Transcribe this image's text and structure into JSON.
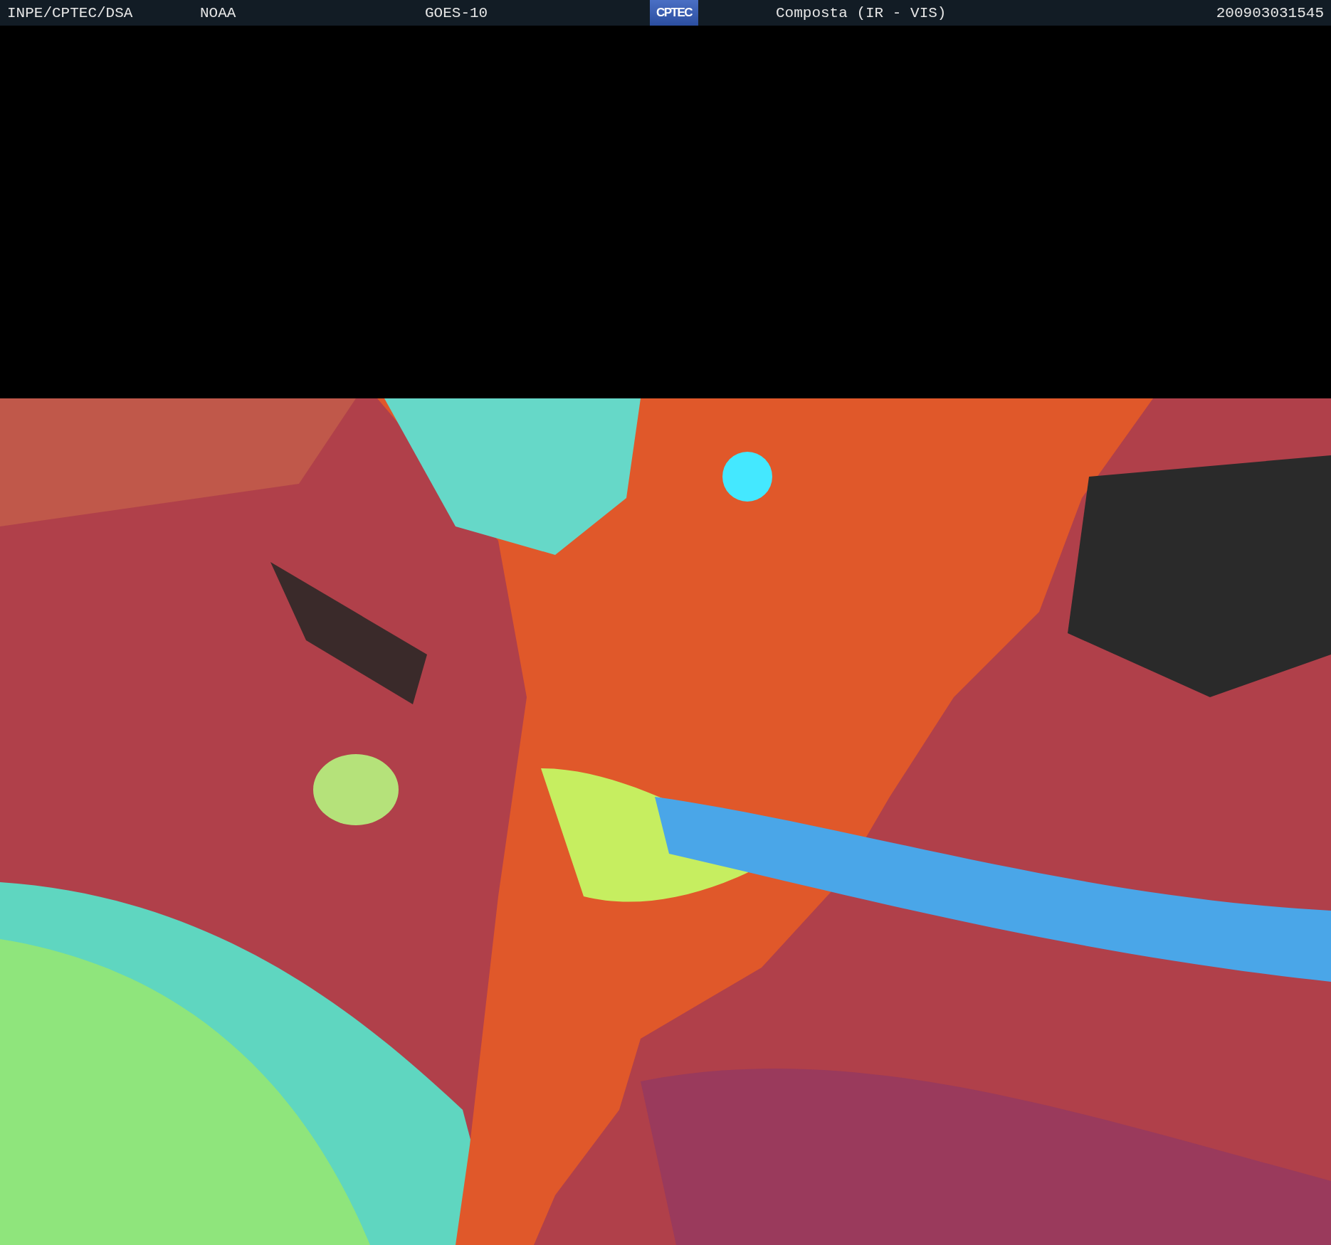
{
  "header": {
    "source": "INPE/CPTEC/DSA",
    "agency": "NOAA",
    "satellite": "GOES-10",
    "logo": "CPTEC",
    "product": "Composta (IR - VIS)",
    "timestamp": "200903031545"
  }
}
